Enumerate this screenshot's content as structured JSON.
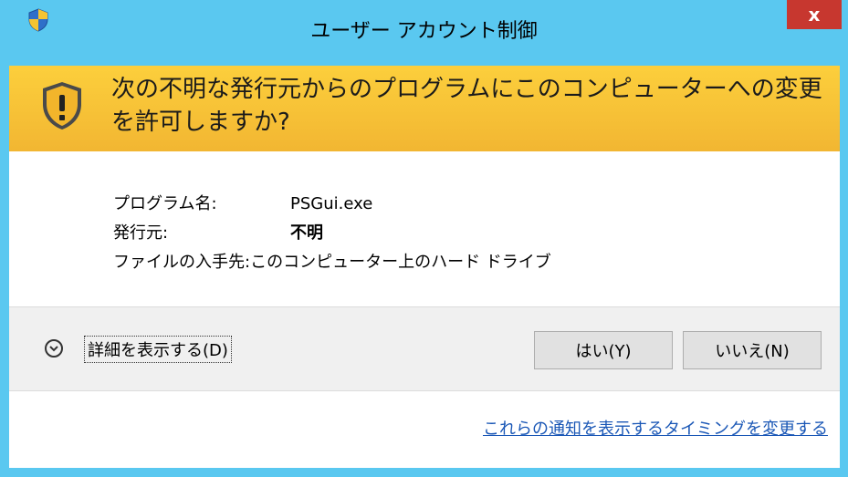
{
  "window": {
    "title": "ユーザー アカウント制御",
    "close_label": "x"
  },
  "banner": {
    "question": "次の不明な発行元からのプログラムにこのコンピューターへの変更を許可しますか?"
  },
  "details": {
    "program_label": "プログラム名:",
    "program_value": "PSGui.exe",
    "publisher_label": "発行元:",
    "publisher_value": "不明",
    "origin_label": "ファイルの入手先:",
    "origin_value": "このコンピューター上のハード ドライブ"
  },
  "actions": {
    "show_details_label": "詳細を表示する(D)",
    "yes_label": "はい(Y)",
    "no_label": "いいえ(N)"
  },
  "footer": {
    "link_label": "これらの通知を表示するタイミングを変更する"
  },
  "icons": {
    "title_shield": "uac-shield-icon",
    "banner_shield": "warning-shield-icon",
    "expand": "chevron-down-circle-icon"
  },
  "colors": {
    "titlebar": "#5ac8f0",
    "banner": "#f7c23a",
    "close_button": "#c7372f",
    "link": "#1a57b6"
  }
}
